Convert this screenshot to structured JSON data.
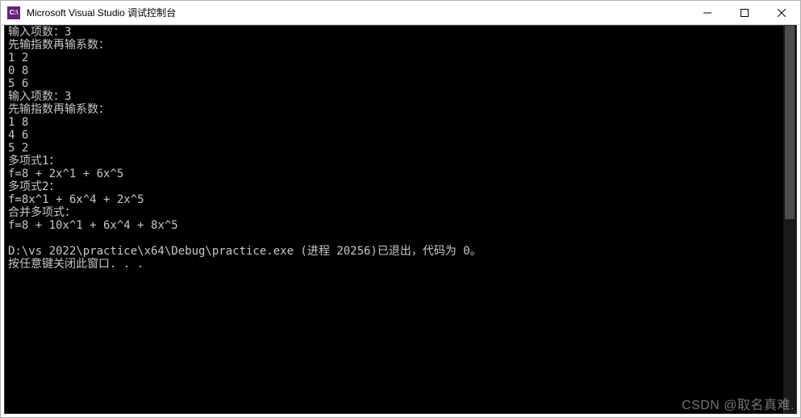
{
  "window": {
    "icon_label": "C:\\",
    "title": "Microsoft Visual Studio 调试控制台"
  },
  "console": {
    "lines": [
      "输入项数：3",
      "先输指数再输系数：",
      "1 2",
      "0 8",
      "5 6",
      "输入项数：3",
      "先输指数再输系数：",
      "1 8",
      "4 6",
      "5 2",
      "多项式1：",
      "f=8 + 2x^1 + 6x^5",
      "多项式2：",
      "f=8x^1 + 6x^4 + 2x^5",
      "合并多项式：",
      "f=8 + 10x^1 + 6x^4 + 8x^5",
      "",
      "D:\\vs 2022\\practice\\x64\\Debug\\practice.exe (进程 20256)已退出，代码为 0。",
      "按任意键关闭此窗口. . ."
    ]
  },
  "watermark": "CSDN @取名真难."
}
